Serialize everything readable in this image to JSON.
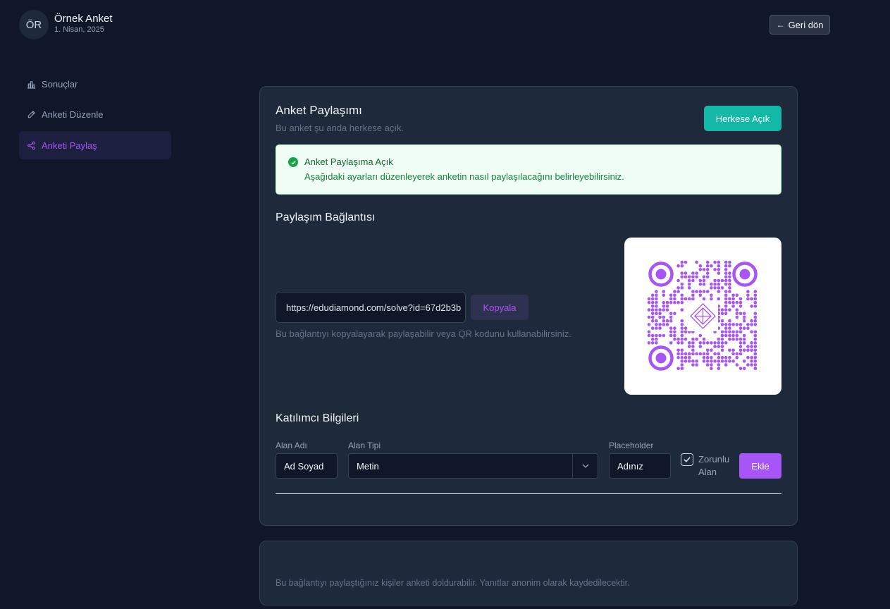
{
  "header": {
    "avatar_initials": "ÖR",
    "title": "Örnek Anket",
    "date": "1. Nisan, 2025",
    "back_label": "Geri dön"
  },
  "sidebar": {
    "items": [
      {
        "label": "Sonuçlar",
        "icon": "chart-icon"
      },
      {
        "label": "Anketi Düzenle",
        "icon": "pencil-icon"
      },
      {
        "label": "Anketi Paylaş",
        "icon": "share-icon",
        "active": true
      }
    ]
  },
  "share": {
    "title": "Anket Paylaşımı",
    "subtitle": "Bu anket şu anda herkese açık.",
    "public_button": "Herkese Açık",
    "alert_title": "Anket Paylaşıma Açık",
    "alert_desc": "Aşağıdaki ayarları düzenleyerek anketin nasıl paylaşılacağını belirleyebilirsiniz.",
    "link_title": "Paylaşım Bağlantısı",
    "link_value": "https://edudiamond.com/solve?id=67d2b3b",
    "copy_button": "Kopyala",
    "link_hint": "Bu bağlantıyı kopyalayarak paylaşabilir veya QR kodunu kullanabilirsiniz."
  },
  "participant": {
    "title": "Katılımcı Bilgileri",
    "name_label": "Alan Adı",
    "name_value": "Ad Soyad",
    "type_label": "Alan Tipi",
    "type_value": "Metin",
    "placeholder_label": "Placeholder",
    "placeholder_value": "Adınız",
    "required_label_1": "Zorunlu",
    "required_label_2": "Alan",
    "required_checked": true,
    "add_button": "Ekle"
  },
  "footer": {
    "note": "Bu bağlantıyı paylaştığınız kişiler anketi doldurabilir. Yanıtlar anonim olarak kaydedilecektir."
  },
  "colors": {
    "accent": "#a855f7",
    "teal": "#14b8a6",
    "background": "#0f1729",
    "card": "#1e293b"
  }
}
